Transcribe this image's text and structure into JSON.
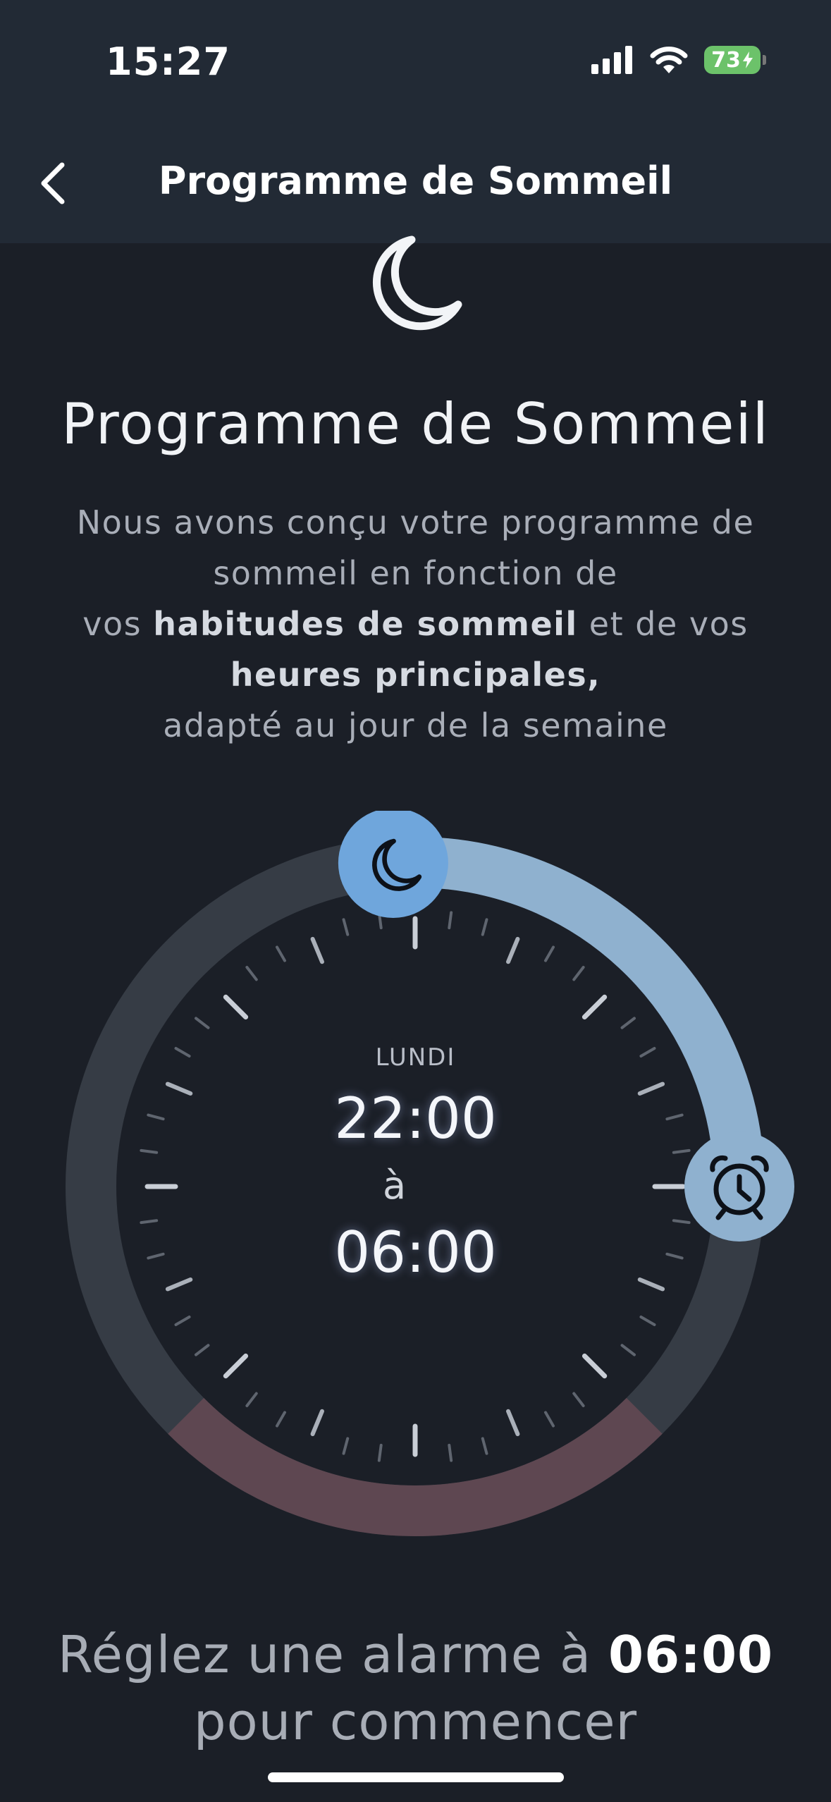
{
  "status_bar": {
    "time": "15:27",
    "battery": "73",
    "signal_icon": "cellular-signal-icon",
    "wifi_icon": "wifi-icon",
    "charging_icon": "bolt-icon"
  },
  "nav": {
    "title": "Programme de Sommeil",
    "back_icon": "chevron-left-icon"
  },
  "hero": {
    "icon": "moon-icon",
    "heading": "Programme de Sommeil",
    "desc_line1": "Nous avons conçu votre programme de",
    "desc_line2": "sommeil en fonction de",
    "desc_line3_pre": "vos ",
    "desc_line3_bold": "habitudes de sommeil",
    "desc_line3_post": " et de vos",
    "desc_line4_bold": "heures principales,",
    "desc_line5": "adapté au jour de la semaine"
  },
  "dial": {
    "day": "LUNDI",
    "start_time": "22:00",
    "separator": "à",
    "end_time": "06:00",
    "bedtime_handle_icon": "moon-icon",
    "wake_handle_icon": "alarm-clock-icon",
    "sleep_fraction": 0.333,
    "colors": {
      "sleep_arc": "#8fb1cf",
      "track": "#363c45",
      "day_arc": "#5e4751",
      "bedtime_handle": "#6fa6dc",
      "wake_handle": "#8fb1cf"
    }
  },
  "footer": {
    "line1_pre": "Réglez une alarme à ",
    "line1_bold": "06:00",
    "line2": "pour commencer"
  }
}
